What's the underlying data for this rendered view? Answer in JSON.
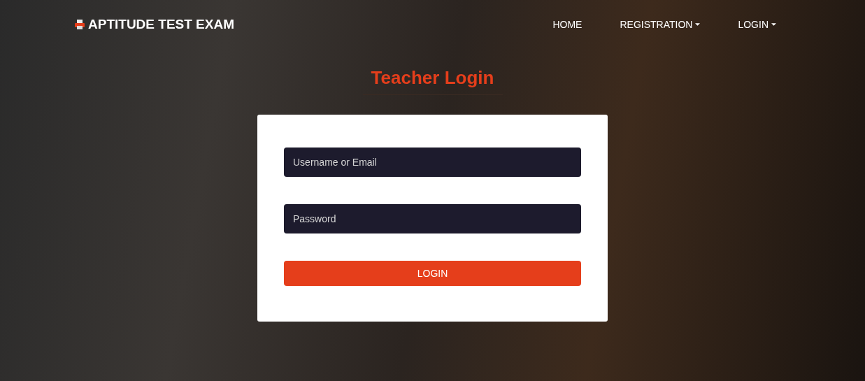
{
  "navbar": {
    "brand": "APTITUDE TEST EXAM",
    "items": [
      {
        "label": "HOME",
        "kind": "link"
      },
      {
        "label": "REGISTRATION",
        "kind": "dropdown"
      },
      {
        "label": "LOGIN",
        "kind": "dropdown"
      }
    ]
  },
  "page_title": "Teacher Login",
  "form": {
    "fields": [
      {
        "placeholder": "Username or Email"
      },
      {
        "placeholder": "Password"
      }
    ],
    "submit": "LOGIN"
  }
}
